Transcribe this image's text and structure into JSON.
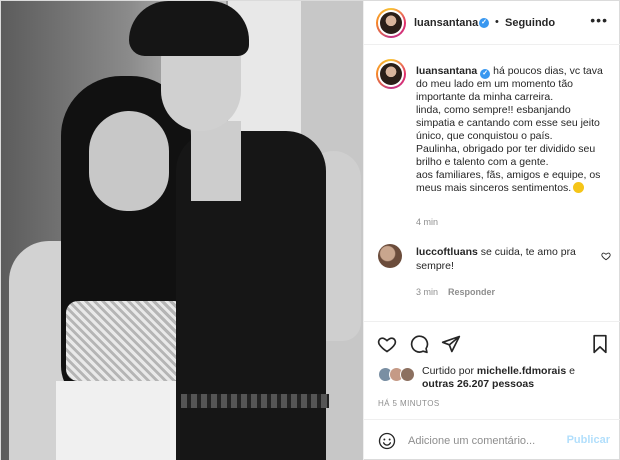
{
  "post": {
    "username": "luansantana",
    "follow_status": "Seguindo",
    "separator": "•",
    "caption_lines": [
      "há poucos dias, vc tava",
      "do meu lado em um momento tão",
      "importante da minha carreira.",
      "linda, como sempre!! esbanjando",
      "simpatia e cantando com esse seu jeito",
      "único, que conquistou o país.",
      "Paulinha, obrigado por ter dividido seu",
      "brilho e talento com a gente.",
      "aos familiares, fãs, amigos e equipe, os",
      "meus mais sinceros sentimentos."
    ],
    "caption_time": "4 min",
    "comment": {
      "username": "luccoftluans",
      "text": "se cuida, te amo pra sempre!",
      "time": "3 min",
      "reply_label": "Responder"
    },
    "likes": {
      "prefix": "Curtido por",
      "first_user": "michelle.fdmorais",
      "and": "e",
      "others": "outras 26.207 pessoas"
    },
    "posted_ago": "HÁ 5 MINUTOS",
    "comment_input_placeholder": "Adicione um comentário...",
    "publish_label": "Publicar"
  },
  "icons": {
    "more": "more-options-icon",
    "verified": "verified-badge-icon",
    "like": "heart-icon",
    "comment": "comment-icon",
    "share": "share-icon",
    "save": "bookmark-icon",
    "emoji": "emoji-icon"
  },
  "colors": {
    "verified_blue": "#3897f0",
    "publish_disabled": "#b2dffc",
    "muted_text": "#8e8e8e"
  }
}
